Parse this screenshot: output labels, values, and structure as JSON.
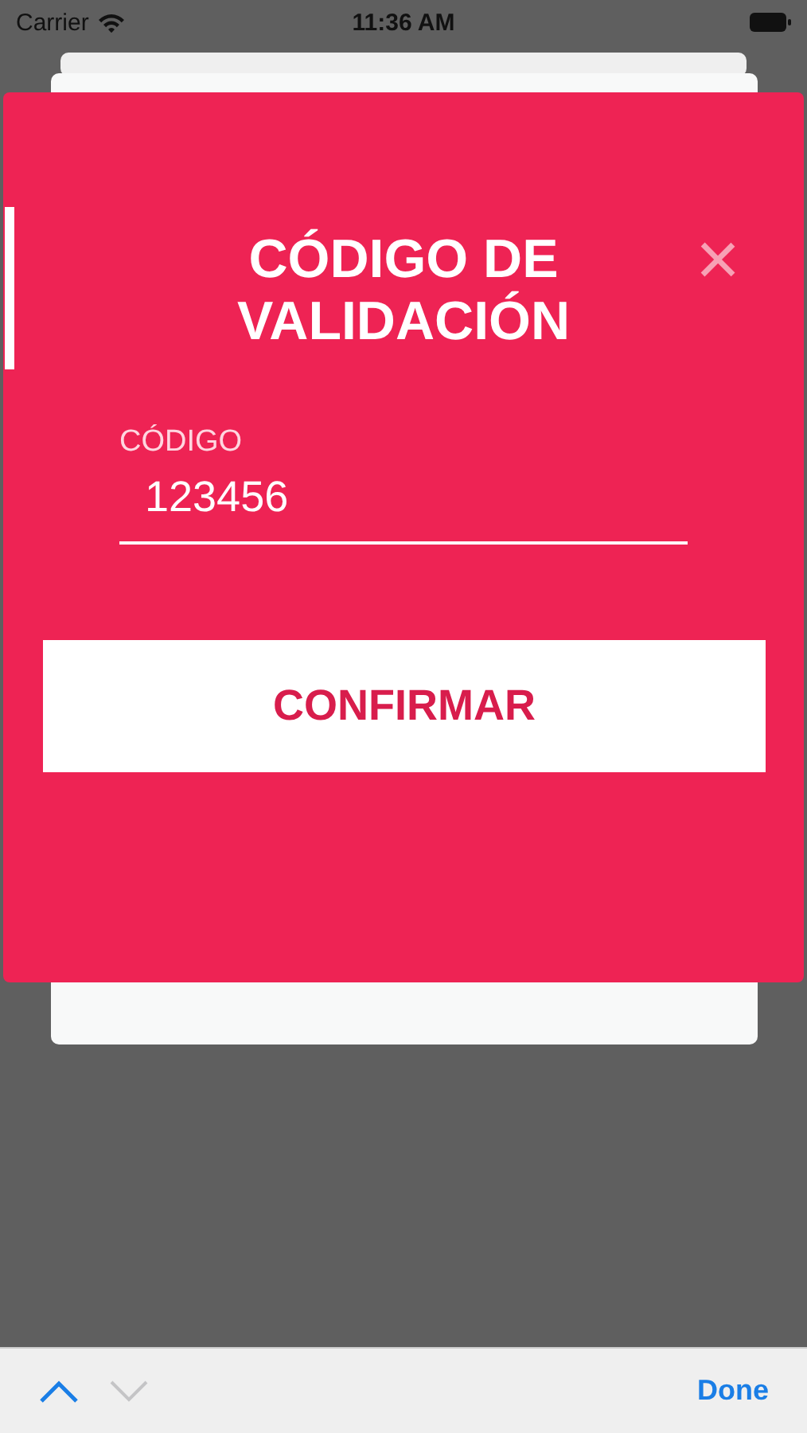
{
  "status_bar": {
    "carrier": "Carrier",
    "time": "11:36 AM"
  },
  "dialog": {
    "title": "CÓDIGO DE VALIDACIÓN",
    "close_label": "×",
    "field": {
      "label": "CÓDIGO",
      "value": "123456"
    },
    "button": "CONFIRMAR"
  },
  "keyboard_toolbar": {
    "previous": {
      "disabled": false
    },
    "next": {
      "disabled": true
    },
    "done": "Done"
  }
}
